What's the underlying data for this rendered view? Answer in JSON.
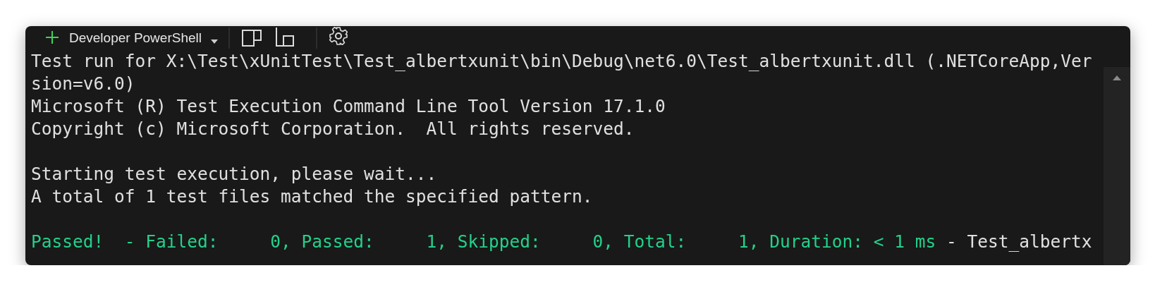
{
  "toolbar": {
    "profile": "Developer PowerShell"
  },
  "blocks": [
    {
      "lines": [
        [
          {
            "kind": "plain",
            "text": "Test run for X:\\Test\\xUnitTest\\Test_albertxunit\\bin\\Debug\\net6.0\\Test_albertxunit.dll (.NETCoreApp,Ver"
          }
        ],
        [
          {
            "kind": "plain",
            "text": "sion=v6.0)"
          }
        ],
        [
          {
            "kind": "plain",
            "text": "Microsoft (R) Test Execution Command Line Tool Version 17.1.0"
          }
        ],
        [
          {
            "kind": "plain",
            "text": "Copyright (c) Microsoft Corporation.  All rights reserved."
          }
        ]
      ]
    },
    {
      "lines": [
        [
          {
            "kind": "plain",
            "text": "Starting test execution, please wait..."
          }
        ],
        [
          {
            "kind": "plain",
            "text": "A total of 1 test files matched the specified pattern."
          }
        ]
      ]
    },
    {
      "lines": [
        [
          {
            "kind": "success",
            "text": "Passed!  - Failed:     0, Passed:     1, Skipped:     0, Total:     1, Duration: < 1 ms"
          },
          {
            "kind": "plain",
            "text": " - Test_albertx"
          }
        ]
      ]
    }
  ]
}
